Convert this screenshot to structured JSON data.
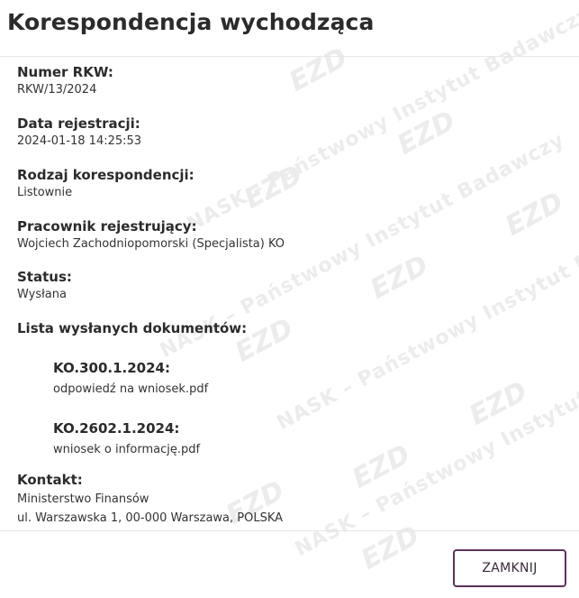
{
  "dialog": {
    "title": "Korespondencja wychodząca"
  },
  "fields": {
    "numer_rkw": {
      "label": "Numer RKW:",
      "value": "RKW/13/2024"
    },
    "data_rejestracji": {
      "label": "Data rejestracji:",
      "value": "2024-01-18 14:25:53"
    },
    "rodzaj": {
      "label": "Rodzaj korespondencji:",
      "value": "Listownie"
    },
    "pracownik": {
      "label": "Pracownik rejestrujący:",
      "value": "Wojciech Zachodniopomorski (Specjalista) KO"
    },
    "status": {
      "label": "Status:",
      "value": "Wysłana"
    },
    "lista": {
      "label": "Lista wysłanych dokumentów:"
    },
    "kontakt": {
      "label": "Kontakt:",
      "line1": "Ministerstwo Finansów",
      "line2": "ul. Warszawska 1, 00-000 Warszawa, POLSKA"
    }
  },
  "documents": [
    {
      "number": "KO.300.1.2024:",
      "file": "odpowiedź na wniosek.pdf"
    },
    {
      "number": "KO.2602.1.2024:",
      "file": "wniosek o informację.pdf"
    }
  ],
  "footer": {
    "close_label": "ZAMKNIJ"
  },
  "watermark": {
    "text": "NASK – Państwowy Instytut Badawczy",
    "logo": "EZD"
  },
  "colors": {
    "button_border": "#5a3358",
    "watermark": "#ececec"
  }
}
